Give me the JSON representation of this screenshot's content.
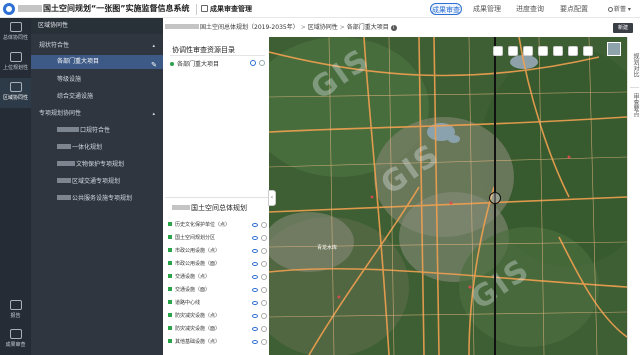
{
  "header": {
    "app_title": "国土空间规划“一张图”实施监督信息系统",
    "module_title": "成果审查管理",
    "nav": [
      {
        "label": "成果审查",
        "active": true
      },
      {
        "label": "成果管理",
        "active": false
      },
      {
        "label": "进度查询",
        "active": false
      },
      {
        "label": "要点配置",
        "active": false
      }
    ],
    "user": "靳蕾"
  },
  "rail": {
    "items": [
      {
        "label": "总体协同性",
        "icon": "target-icon"
      },
      {
        "label": "上位规划性",
        "icon": "layers-icon"
      },
      {
        "label": "区域协同性",
        "icon": "regional-icon"
      },
      {
        "label": "报告",
        "icon": "report-icon"
      },
      {
        "label": "成果审查",
        "icon": "review-icon"
      }
    ]
  },
  "sidebar": {
    "header": "区域协同性",
    "items": [
      {
        "label": "规状符合性",
        "level": 1,
        "expanded": true
      },
      {
        "label": "各部门重大项目",
        "level": 2,
        "active": true
      },
      {
        "label": "等级设施",
        "level": 2
      },
      {
        "label": "综合交通设施",
        "level": 2
      },
      {
        "label": "专项规划协同性",
        "level": 1,
        "expanded": true
      },
      {
        "label": "口规符合性",
        "level": 2
      },
      {
        "label": "一体化规划",
        "level": 2
      },
      {
        "label": "文物保护专项规划",
        "level": 2
      },
      {
        "label": "区域交通专项规划",
        "level": 2
      },
      {
        "label": "公共服务设施专项规划",
        "level": 2
      }
    ]
  },
  "breadcrumb": {
    "plan": "国土空间总体规划（2019-2035年）",
    "section": "区域协同性",
    "item": "各部门重大项目"
  },
  "panel": {
    "title": "协调性审查资源目录",
    "resource_item": "各部门重大项目",
    "plan_title": "国土空间总体规划",
    "layers": [
      "历史文化保护单位（点）",
      "国土空间规划分区",
      "市政公用设施（点）",
      "市政公用设施（面）",
      "交通设施（点）",
      "交通设施（面）",
      "道路中心线",
      "防灾减灾设施（点）",
      "防灾减灾设施（面）",
      "其他基础设施（点）"
    ]
  },
  "map": {
    "labels": [
      "青龙水库"
    ],
    "watermark": "GIS"
  },
  "right_rail": {
    "buttons": [
      "规划对比",
      "审查要点"
    ],
    "new_button": "新建"
  },
  "colors": {
    "accent": "#2d6fd3",
    "rail_bg": "#252c35",
    "sidebar_bg": "#2f3640",
    "active_item": "#3d5a86",
    "road_orange": "#f0a050",
    "layer_check": "#2aa34b"
  }
}
